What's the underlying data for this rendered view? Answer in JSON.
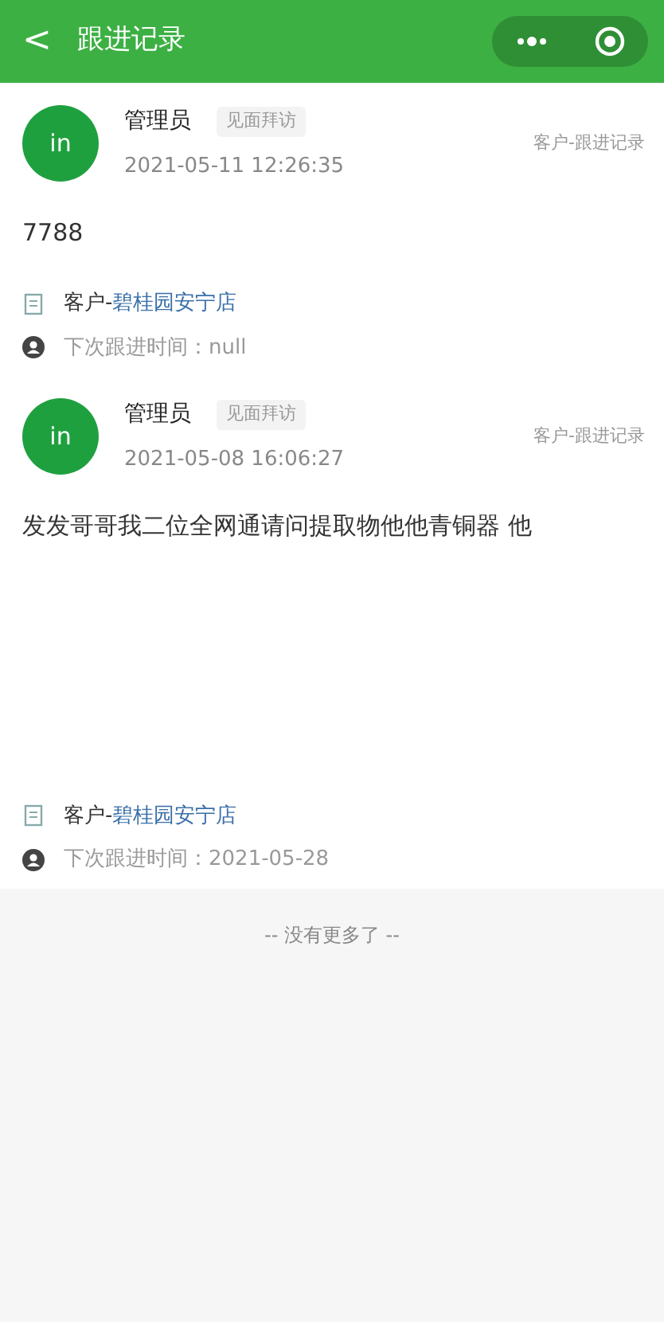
{
  "header": {
    "back": "<",
    "title": "跟进记录"
  },
  "records": [
    {
      "avatar": "in",
      "author": "管理员",
      "tag": "见面拜访",
      "time": "2021-05-11 12:26:35",
      "source": "客户-跟进记录",
      "content": "7788",
      "customer_prefix": "客户-",
      "customer_name": "碧桂园安宁店",
      "next_followup": "下次跟进时间：null"
    },
    {
      "avatar": "in",
      "author": "管理员",
      "tag": "见面拜访",
      "time": "2021-05-08 16:06:27",
      "source": "客户-跟进记录",
      "content": "发发哥哥我二位全网通请问提取物他他青铜器 他",
      "customer_prefix": "客户-",
      "customer_name": "碧桂园安宁店",
      "next_followup": "下次跟进时间：2021-05-28"
    }
  ],
  "footer": "-- 没有更多了 --"
}
